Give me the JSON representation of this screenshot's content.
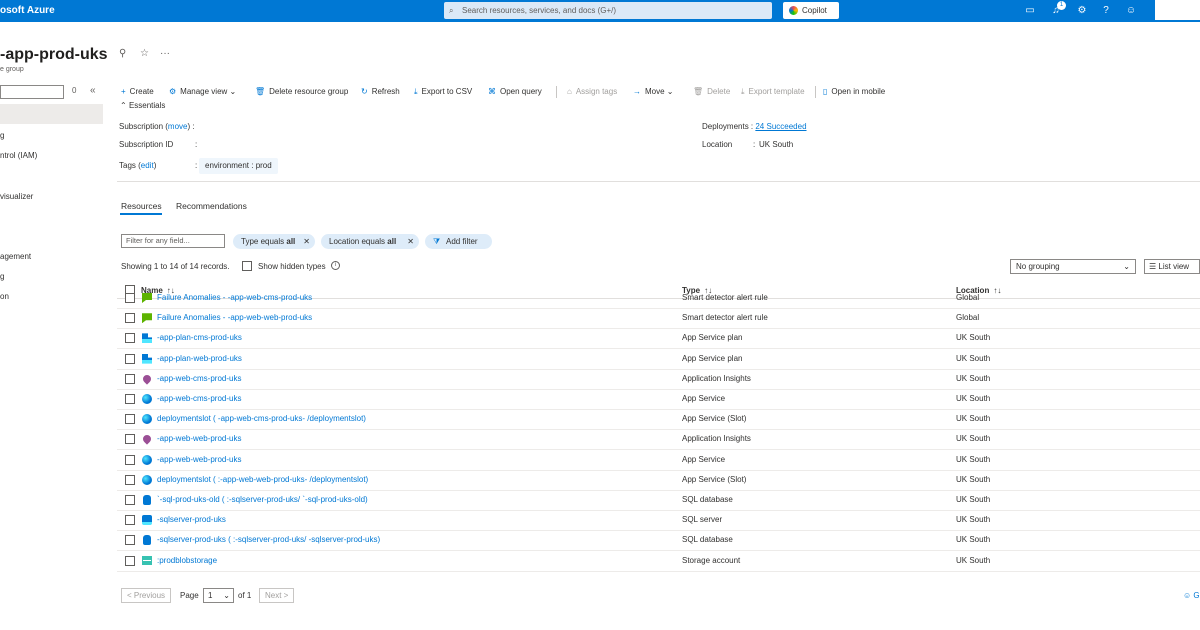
{
  "topbar": {
    "brand": "osoft Azure",
    "search_placeholder": "Search resources, services, and docs (G+/)",
    "copilot_label": "Copilot",
    "notification_count": "1"
  },
  "header": {
    "title": "-app-prod-uks",
    "subtitle": "e group"
  },
  "left_nav": {
    "search_hint": "0",
    "items": [
      "g",
      "ntrol (IAM)",
      "visualizer",
      "agement",
      "g",
      "on"
    ]
  },
  "commands": {
    "create": "Create",
    "manage_view": "Manage view",
    "delete_rg": "Delete resource group",
    "refresh": "Refresh",
    "export_csv": "Export to CSV",
    "open_query": "Open query",
    "assign_tags": "Assign tags",
    "move": "Move",
    "delete": "Delete",
    "export_template": "Export template",
    "open_mobile": "Open in mobile"
  },
  "essentials": {
    "title": "Essentials",
    "subscription_label": "Subscription",
    "subscription_move": "move",
    "subscription_id_label": "Subscription ID",
    "tags_label": "Tags",
    "tags_edit": "edit",
    "tag_value": "environment : prod",
    "deployments_label": "Deployments",
    "deployments_value": "24 Succeeded",
    "location_label": "Location",
    "location_value": "UK South"
  },
  "tabs": {
    "resources": "Resources",
    "recommendations": "Recommendations"
  },
  "filters": {
    "placeholder": "Filter for any field...",
    "type_prefix": "Type equals ",
    "type_value": "all",
    "location_prefix": "Location equals ",
    "location_value": "all",
    "add_filter": "Add filter"
  },
  "list_info": {
    "showing": "Showing 1 to 14 of 14 records.",
    "show_hidden": "Show hidden types",
    "grouping": "No grouping",
    "list_view": "List view"
  },
  "table": {
    "headers": {
      "name": "Name",
      "type": "Type",
      "location": "Location"
    },
    "rows": [
      {
        "icon": "alert",
        "name": "Failure Anomalies -        -app-web-cms-prod-uks",
        "type": "Smart detector alert rule",
        "location": "Global"
      },
      {
        "icon": "alert",
        "name": "Failure Anomalies -        -app-web-web-prod-uks",
        "type": "Smart detector alert rule",
        "location": "Global"
      },
      {
        "icon": "plan",
        "name": "      -app-plan-cms-prod-uks",
        "type": "App Service plan",
        "location": "UK South"
      },
      {
        "icon": "plan",
        "name": "      -app-plan-web-prod-uks",
        "type": "App Service plan",
        "location": "UK South"
      },
      {
        "icon": "insights",
        "name": "      -app-web-cms-prod-uks",
        "type": "Application Insights",
        "location": "UK South"
      },
      {
        "icon": "web",
        "name": "      -app-web-cms-prod-uks",
        "type": "App Service",
        "location": "UK South"
      },
      {
        "icon": "web",
        "name": "deploymentslot (      -app-web-cms-prod-uks-      /deploymentslot)",
        "type": "App Service (Slot)",
        "location": "UK South"
      },
      {
        "icon": "insights",
        "name": "      -app-web-web-prod-uks",
        "type": "Application Insights",
        "location": "UK South"
      },
      {
        "icon": "web",
        "name": "      -app-web-web-prod-uks",
        "type": "App Service",
        "location": "UK South"
      },
      {
        "icon": "web",
        "name": "deploymentslot (     :-app-web-web-prod-uks-      /deploymentslot)",
        "type": "App Service (Slot)",
        "location": "UK South"
      },
      {
        "icon": "sql",
        "name": "     `-sql-prod-uks-old (     :-sqlserver-prod-uks/     `-sql-prod-uks-old)",
        "type": "SQL database",
        "location": "UK South"
      },
      {
        "icon": "sqlsrv",
        "name": "      -sqlserver-prod-uks",
        "type": "SQL server",
        "location": "UK South"
      },
      {
        "icon": "sql",
        "name": "      -sqlserver-prod-uks (      :-sqlserver-prod-uks/      -sqlserver-prod-uks)",
        "type": "SQL database",
        "location": "UK South"
      },
      {
        "icon": "storage",
        "name": "      :prodblobstorage",
        "type": "Storage account",
        "location": "UK South"
      }
    ]
  },
  "pagination": {
    "previous": "< Previous",
    "page_label": "Page",
    "page_value": "1",
    "of_label": "of 1",
    "next": "Next >",
    "corner": "G"
  }
}
